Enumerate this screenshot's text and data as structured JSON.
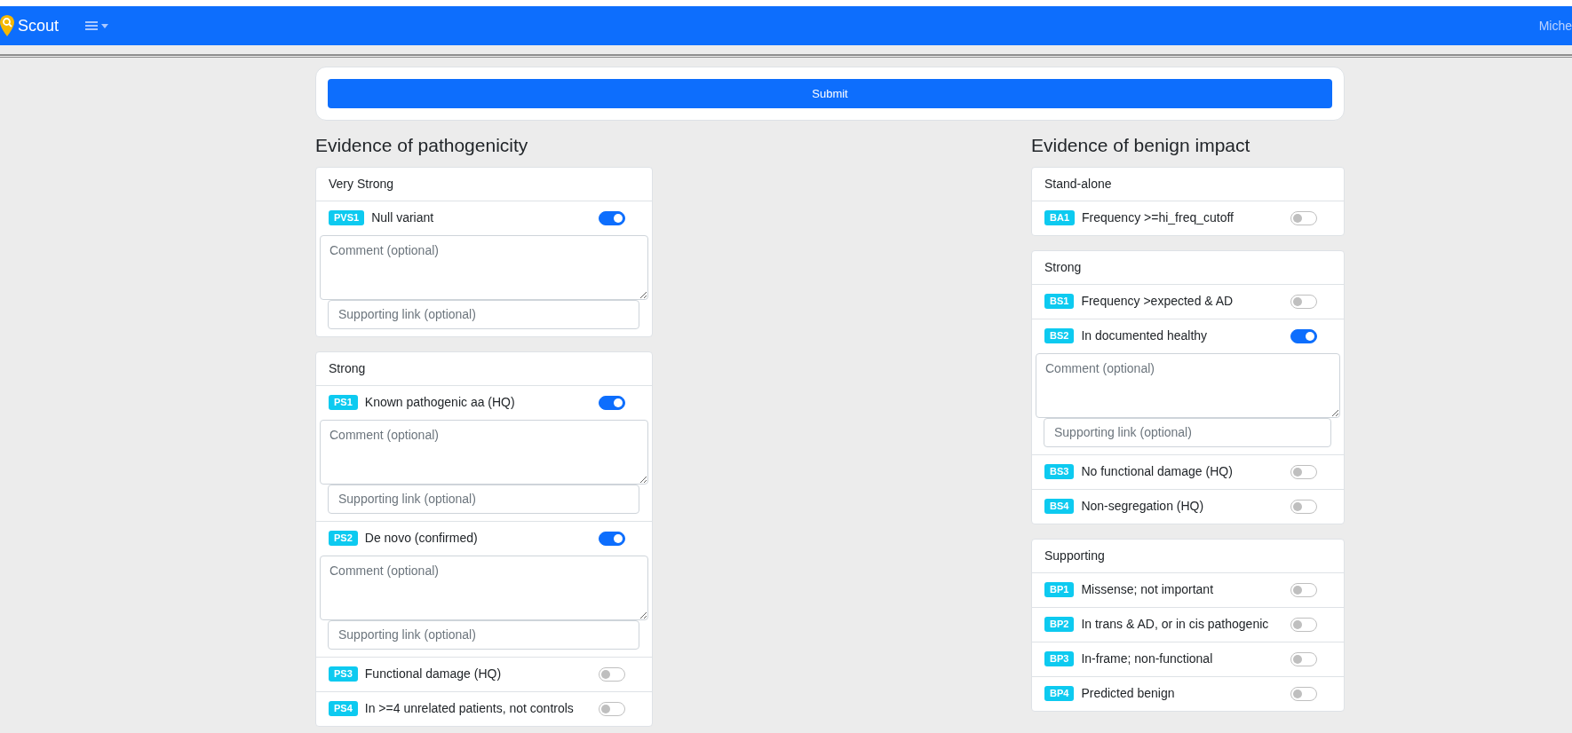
{
  "navbar": {
    "brand": "Scout",
    "user": "Miche"
  },
  "submit": "Submit",
  "columns": [
    {
      "title": "Evidence of pathogenicity",
      "groups": [
        {
          "title": "Very Strong",
          "criteria": [
            {
              "code": "PVS1",
              "label": "Null variant",
              "on": true,
              "comment_placeholder": "Comment (optional)",
              "link_placeholder": "Supporting link (optional)"
            }
          ]
        },
        {
          "title": "Strong",
          "criteria": [
            {
              "code": "PS1",
              "label": "Known pathogenic aa (HQ)",
              "on": true,
              "comment_placeholder": "Comment (optional)",
              "link_placeholder": "Supporting link (optional)"
            },
            {
              "code": "PS2",
              "label": "De novo (confirmed)",
              "on": true,
              "comment_placeholder": "Comment (optional)",
              "link_placeholder": "Supporting link (optional)"
            },
            {
              "code": "PS3",
              "label": "Functional damage (HQ)",
              "on": false
            },
            {
              "code": "PS4",
              "label": "In >=4 unrelated patients, not controls",
              "on": false
            }
          ]
        }
      ]
    },
    {
      "title": "Evidence of benign impact",
      "groups": [
        {
          "title": "Stand-alone",
          "criteria": [
            {
              "code": "BA1",
              "label": "Frequency >=hi_freq_cutoff",
              "on": false
            }
          ]
        },
        {
          "title": "Strong",
          "criteria": [
            {
              "code": "BS1",
              "label": "Frequency >expected & AD",
              "on": false
            },
            {
              "code": "BS2",
              "label": "In documented healthy",
              "on": true,
              "comment_placeholder": "Comment (optional)",
              "link_placeholder": "Supporting link (optional)"
            },
            {
              "code": "BS3",
              "label": "No functional damage (HQ)",
              "on": false
            },
            {
              "code": "BS4",
              "label": "Non-segregation (HQ)",
              "on": false
            }
          ]
        },
        {
          "title": "Supporting",
          "criteria": [
            {
              "code": "BP1",
              "label": "Missense; not important",
              "on": false
            },
            {
              "code": "BP2",
              "label": "In trans & AD, or in cis pathogenic",
              "on": false
            },
            {
              "code": "BP3",
              "label": "In-frame; non-functional",
              "on": false
            },
            {
              "code": "BP4",
              "label": "Predicted benign",
              "on": false
            }
          ]
        }
      ]
    }
  ]
}
